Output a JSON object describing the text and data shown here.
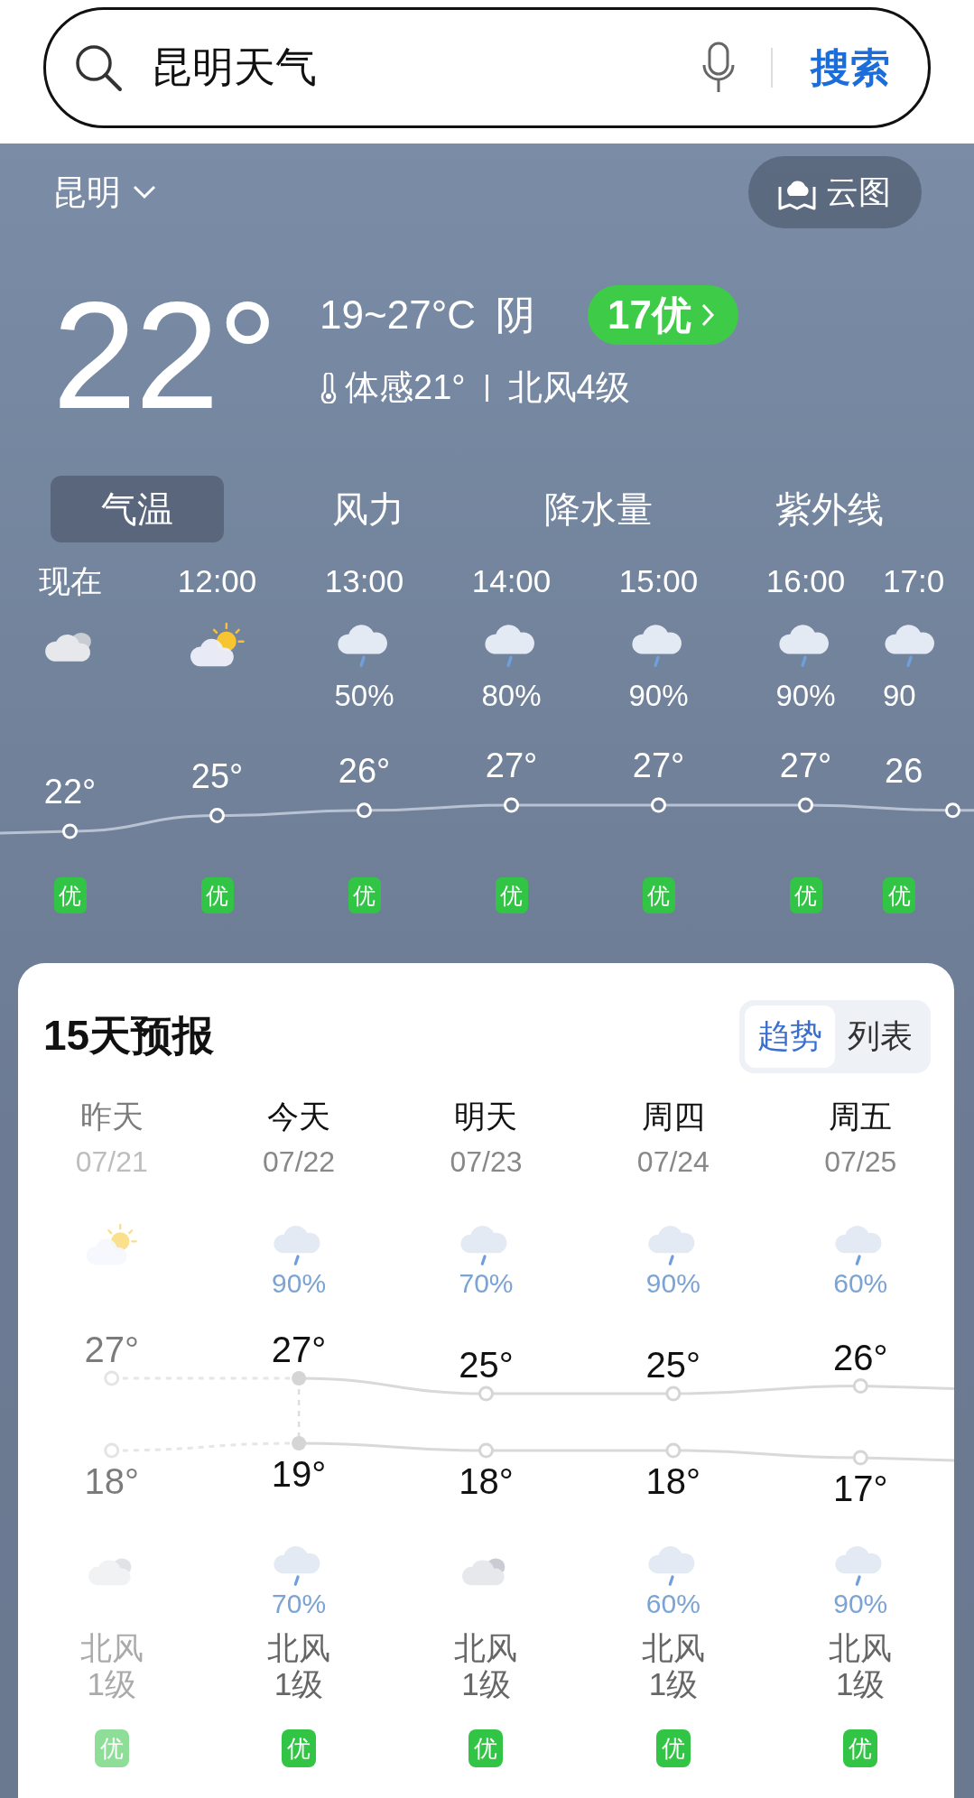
{
  "search": {
    "query": "昆明天气",
    "button": "搜索"
  },
  "location": {
    "city": "昆明",
    "map_button": "云图"
  },
  "current": {
    "temperature": "22°",
    "range": "19~27°C",
    "condition": "阴",
    "aqi": "17优",
    "feels_like": "体感21°",
    "wind": "北风4级"
  },
  "tabs": [
    {
      "label": "气温",
      "selected": true
    },
    {
      "label": "风力",
      "selected": false
    },
    {
      "label": "降水量",
      "selected": false
    },
    {
      "label": "紫外线",
      "selected": false
    }
  ],
  "hourly": [
    {
      "time": "现在",
      "kind": "cloudy",
      "temp": "22°",
      "aqi": "优"
    },
    {
      "time": "12:00",
      "kind": "sunny-cloudy",
      "temp": "25°",
      "aqi": "优"
    },
    {
      "time": "13:00",
      "kind": "rain",
      "rain": "50%",
      "temp": "26°",
      "aqi": "优"
    },
    {
      "time": "14:00",
      "kind": "rain",
      "rain": "80%",
      "temp": "27°",
      "aqi": "优"
    },
    {
      "time": "15:00",
      "kind": "rain",
      "rain": "90%",
      "temp": "27°",
      "aqi": "优"
    },
    {
      "time": "16:00",
      "kind": "rain",
      "rain": "90%",
      "temp": "27°",
      "aqi": "优"
    },
    {
      "time": "17:0",
      "kind": "rain",
      "rain": "90",
      "temp": "26",
      "aqi": "优"
    }
  ],
  "forecast": {
    "title": "15天预报",
    "view_toggle": [
      {
        "label": "趋势",
        "selected": true
      },
      {
        "label": "列表",
        "selected": false
      }
    ],
    "days": [
      {
        "day": "昨天",
        "date": "07/21",
        "past": true,
        "daytime": {
          "kind": "sunny-cloudy"
        },
        "high": "27°",
        "low": "18°",
        "night": {
          "kind": "cloudy"
        },
        "wind_direction": "北风",
        "wind_level": "1级",
        "aqi": "优"
      },
      {
        "day": "今天",
        "date": "07/22",
        "past": false,
        "daytime": {
          "kind": "rain",
          "rain": "90%"
        },
        "high": "27°",
        "low": "19°",
        "night": {
          "kind": "rain",
          "rain": "70%"
        },
        "wind_direction": "北风",
        "wind_level": "1级",
        "aqi": "优"
      },
      {
        "day": "明天",
        "date": "07/23",
        "past": false,
        "daytime": {
          "kind": "rain",
          "rain": "70%"
        },
        "high": "25°",
        "low": "18°",
        "night": {
          "kind": "cloudy"
        },
        "wind_direction": "北风",
        "wind_level": "1级",
        "aqi": "优"
      },
      {
        "day": "周四",
        "date": "07/24",
        "past": false,
        "daytime": {
          "kind": "rain",
          "rain": "90%"
        },
        "high": "25°",
        "low": "18°",
        "night": {
          "kind": "rain",
          "rain": "60%"
        },
        "wind_direction": "北风",
        "wind_level": "1级",
        "aqi": "优"
      },
      {
        "day": "周五",
        "date": "07/25",
        "past": false,
        "daytime": {
          "kind": "rain",
          "rain": "60%"
        },
        "high": "26°",
        "low": "17°",
        "night": {
          "kind": "rain",
          "rain": "90%"
        },
        "wind_direction": "北风",
        "wind_level": "1级",
        "aqi": "优"
      }
    ]
  }
}
